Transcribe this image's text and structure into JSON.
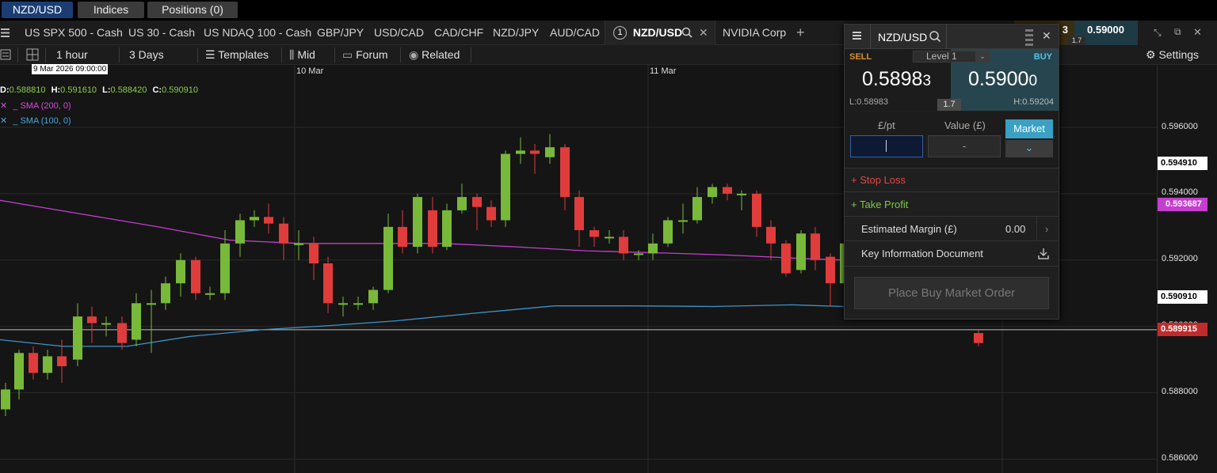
{
  "top_tabs": [
    {
      "label": "NZD/USD",
      "active": true
    },
    {
      "label": "Indices"
    },
    {
      "label": "Positions (0)"
    }
  ],
  "instrument_tabs": [
    "US SPX 500 - Cash",
    "US 30 - Cash",
    "US NDAQ 100 - Cash",
    "GBP/JPY",
    "USD/CAD",
    "CAD/CHF",
    "NZD/JPY",
    "AUD/CAD"
  ],
  "active_instrument": {
    "badge": "1",
    "label": "NZD/USD"
  },
  "next_instrument": "NVIDIA Corp",
  "mini_quote": {
    "sell_fragment": "3",
    "buy": "0.59000",
    "spread": "1.7"
  },
  "toolbar": {
    "interval": "1 hour",
    "range": "3 Days",
    "templates": "Templates",
    "mid": "Mid",
    "forum": "Forum",
    "related": "Related",
    "settings": "Settings"
  },
  "chart": {
    "hover_date": "9 Mar 2026 09:00:00",
    "date_labels": [
      "10 Mar",
      "11 Mar"
    ],
    "ohlc": {
      "o_label": "O:",
      "o": "0.588810",
      "h_label": "H:",
      "h": "0.591610",
      "l_label": "L:",
      "l": "0.588420",
      "c_label": "C:",
      "c": "0.590910"
    },
    "sma200": "SMA (200, 0)",
    "sma100": "SMA (100, 0)",
    "ticks": [
      "0.596000",
      "0.594000",
      "0.592000",
      "0.590000",
      "0.588000",
      "0.586000"
    ],
    "price_labels": {
      "high_line": "0.594910",
      "sma200": "0.593687",
      "close": "0.590910",
      "current": "0.589915"
    },
    "colors": {
      "up": "#79b93a",
      "down": "#e03c3c",
      "sma200": "#c53ed0",
      "sma100": "#3d93c9",
      "current": "#c22b2b"
    }
  },
  "ticket": {
    "symbol": "NZD/USD",
    "sell_label": "SELL",
    "buy_label": "BUY",
    "level": "Level 1",
    "sell_big": "0.5898",
    "sell_small": "3",
    "buy_big": "0.5900",
    "buy_small": "0",
    "low": "L:0.58983",
    "high": "H:0.59204",
    "spread": "1.7",
    "col_per_pt": "£/pt",
    "col_value": "Value (£)",
    "order_type": "Market",
    "value_placeholder": "-",
    "stop_loss": "+ Stop Loss",
    "take_profit": "+ Take Profit",
    "est_margin_label": "Estimated Margin (£)",
    "est_margin_value": "0.00",
    "kid": "Key Information Document",
    "place": "Place Buy Market Order"
  }
}
